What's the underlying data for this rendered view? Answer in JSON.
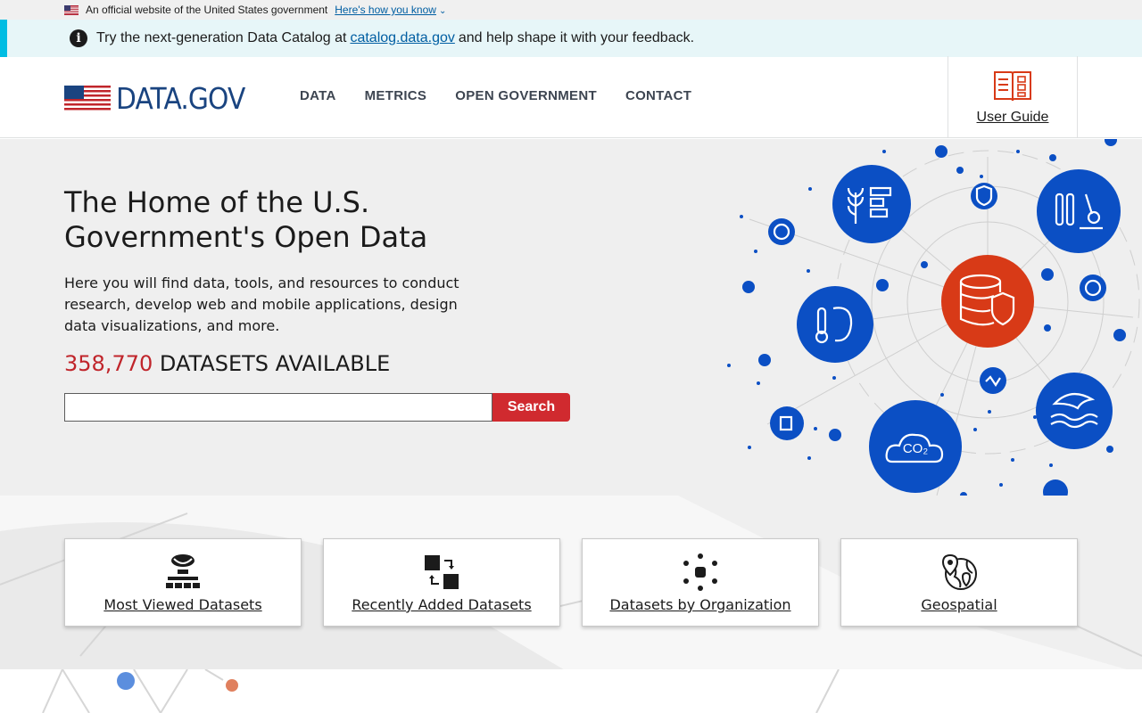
{
  "gov_banner": {
    "text": "An official website of the United States government",
    "link": "Here's how you know"
  },
  "alert": {
    "before": "Try the next-generation Data Catalog at",
    "link": "catalog.data.gov",
    "after": "and help shape it with your feedback."
  },
  "header": {
    "logo_text": "DATA.GOV",
    "nav": [
      "DATA",
      "METRICS",
      "OPEN GOVERNMENT",
      "CONTACT"
    ],
    "user_guide": "User Guide"
  },
  "hero": {
    "title": "The Home of the U.S. Government's Open Data",
    "lead": "Here you will find data, tools, and resources to conduct research, develop web and mobile applications, design data visualizations, and more.",
    "dataset_count": "358,770",
    "dataset_suffix": "DATASETS AVAILABLE",
    "search_value": "",
    "search_button": "Search"
  },
  "cards": [
    {
      "label": "Most Viewed Datasets",
      "icon": "hierarchy-icon"
    },
    {
      "label": "Recently Added Datasets",
      "icon": "swap-squares-icon"
    },
    {
      "label": "Datasets by Organization",
      "icon": "organization-dots-icon"
    },
    {
      "label": "Geospatial",
      "icon": "globe-pin-icon"
    }
  ],
  "colors": {
    "primary_blue": "#0b4fc4",
    "accent_red": "#d83a17",
    "search_red": "#d02a2f",
    "count_red": "#c0252b",
    "link_blue": "#005ea2",
    "alert_bg": "#e7f6f8",
    "alert_border": "#00bde3"
  }
}
